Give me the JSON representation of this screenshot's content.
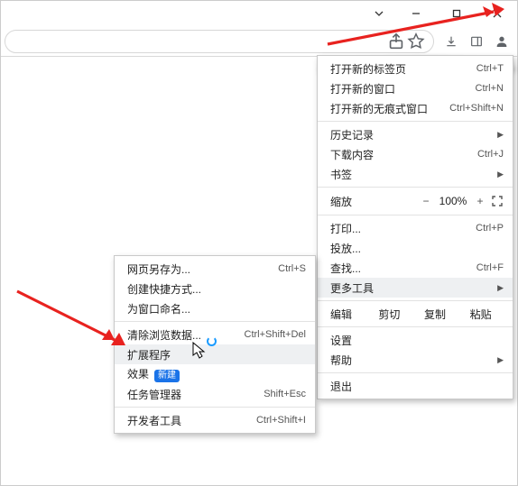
{
  "main_menu": {
    "new_tab": {
      "label": "打开新的标签页",
      "shortcut": "Ctrl+T"
    },
    "new_window": {
      "label": "打开新的窗口",
      "shortcut": "Ctrl+N"
    },
    "new_incognito": {
      "label": "打开新的无痕式窗口",
      "shortcut": "Ctrl+Shift+N"
    },
    "history": {
      "label": "历史记录"
    },
    "downloads": {
      "label": "下载内容",
      "shortcut": "Ctrl+J"
    },
    "bookmarks": {
      "label": "书签"
    },
    "zoom_label": "缩放",
    "zoom_value": "100%",
    "print": {
      "label": "打印...",
      "shortcut": "Ctrl+P"
    },
    "cast": {
      "label": "投放..."
    },
    "find": {
      "label": "查找...",
      "shortcut": "Ctrl+F"
    },
    "more_tools": {
      "label": "更多工具"
    },
    "edit_label": "编辑",
    "edit_cut": "剪切",
    "edit_copy": "复制",
    "edit_paste": "粘贴",
    "settings": {
      "label": "设置"
    },
    "help": {
      "label": "帮助"
    },
    "exit": {
      "label": "退出"
    }
  },
  "submenu": {
    "save_page": {
      "label": "网页另存为...",
      "shortcut": "Ctrl+S"
    },
    "create_shortcut": {
      "label": "创建快捷方式..."
    },
    "name_window": {
      "label": "为窗口命名..."
    },
    "clear_browsing": {
      "label": "清除浏览数据...",
      "shortcut": "Ctrl+Shift+Del"
    },
    "extensions": {
      "label": "扩展程序"
    },
    "performance": {
      "label": "效果",
      "badge": "新建"
    },
    "task_manager": {
      "label": "任务管理器",
      "shortcut": "Shift+Esc"
    },
    "dev_tools": {
      "label": "开发者工具",
      "shortcut": "Ctrl+Shift+I"
    }
  }
}
